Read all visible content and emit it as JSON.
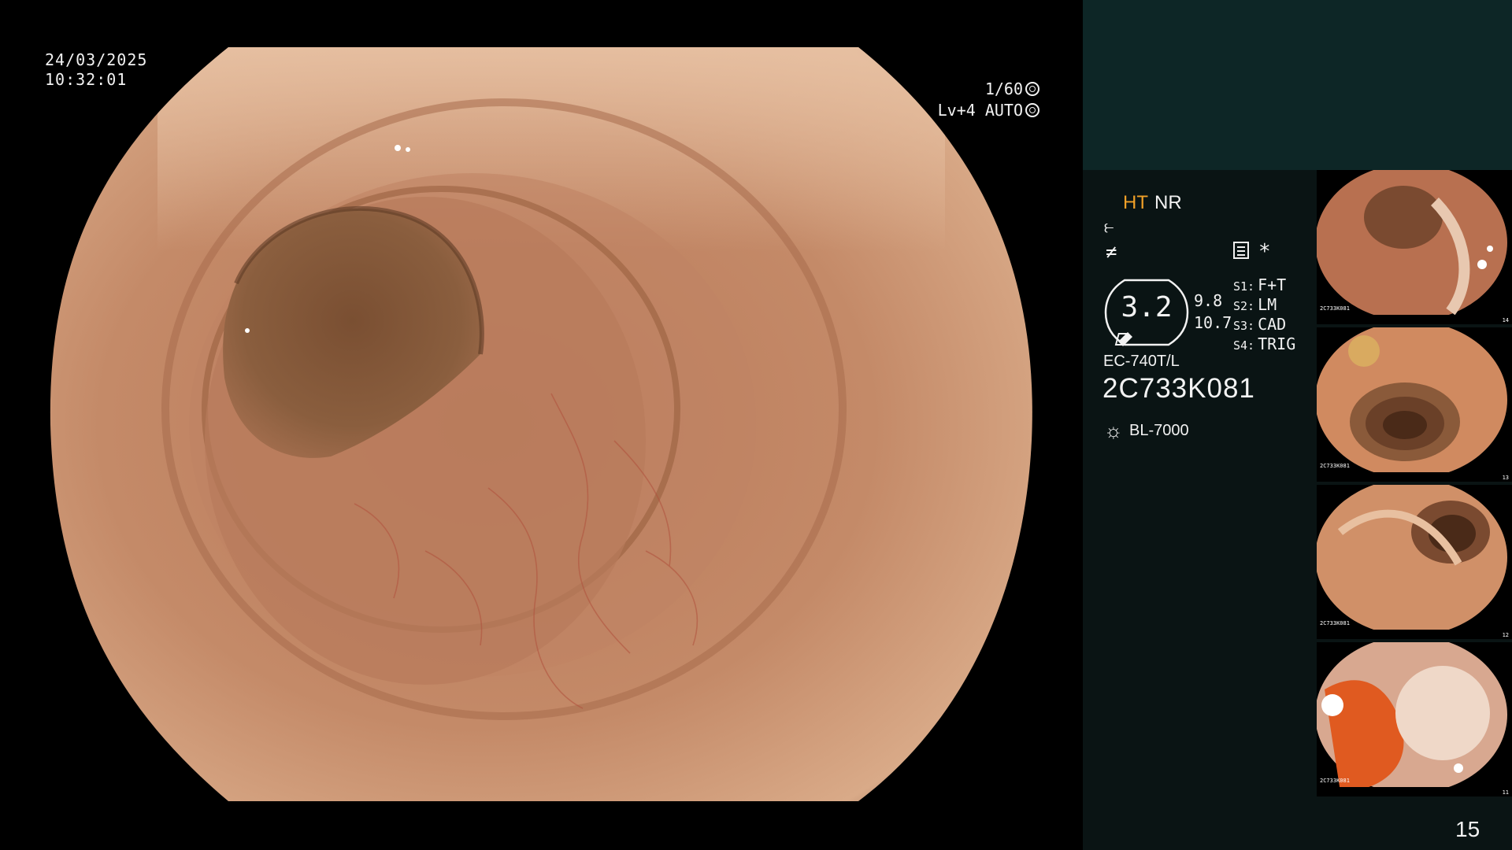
{
  "overlay": {
    "date": "24/03/2025",
    "time": "10:32:01",
    "shutter": "1/60",
    "level": "Lv+4 AUTO"
  },
  "panel": {
    "ht": "HT",
    "nr": "NR",
    "bracket_value": "3.2",
    "value_1": "9.8",
    "value_2": "10.7",
    "switches": [
      {
        "key": "S1:",
        "value": "F+T"
      },
      {
        "key": "S2:",
        "value": "LM"
      },
      {
        "key": "S3:",
        "value": "CAD"
      },
      {
        "key": "S4:",
        "value": "TRIG"
      }
    ],
    "scope_model": "EC-740T/L",
    "serial": "2C733K081",
    "light_source": "BL-7000",
    "asterisk": "*"
  },
  "thumbnails": [
    {
      "label": "2C733K081",
      "num": "14"
    },
    {
      "label": "2C733K081",
      "num": "13"
    },
    {
      "label": "2C733K081",
      "num": "12"
    },
    {
      "label": "2C733K081",
      "num": "11"
    }
  ],
  "page_number": "15",
  "colors": {
    "ht_accent": "#f0a028",
    "panel_bg": "#0a1414",
    "panel_top": "#0d2626"
  }
}
